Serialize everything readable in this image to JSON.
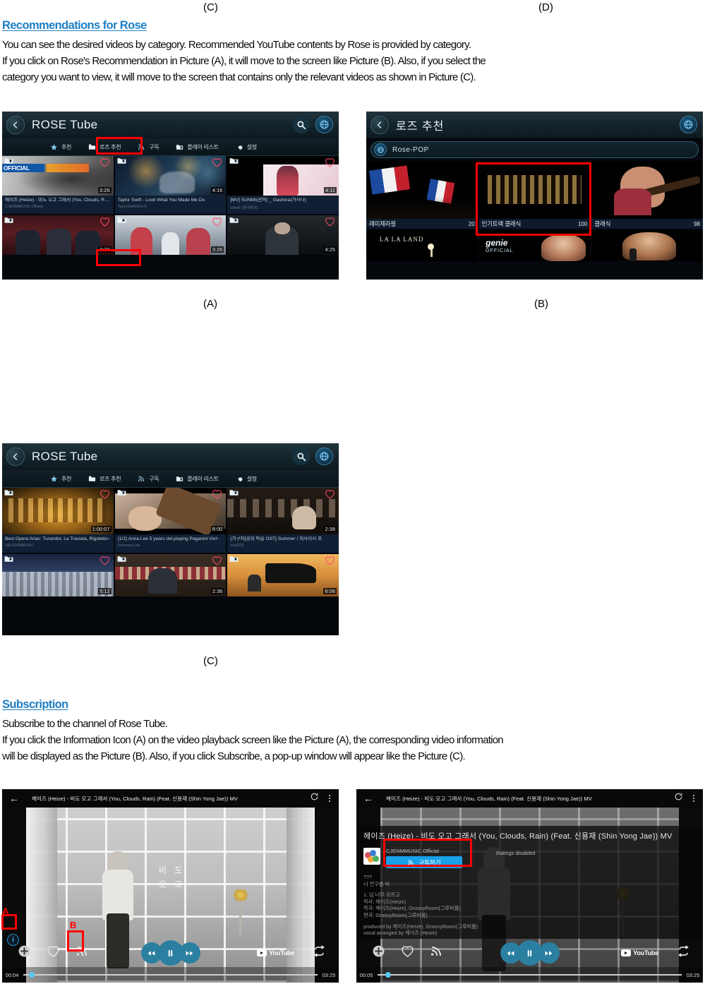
{
  "doc": {
    "top_refs": [
      "(C)",
      "(D)"
    ],
    "section1": {
      "heading": "Recommendations for Rose",
      "lines": [
        "You can see the desired videos by category. Recommended YouTube contents by Rose is provided by category.",
        "If you click on Rose's Recommendation in Picture (A), it will move to the screen like Picture (B). Also, if you select the",
        "category you want to view, it will move to the screen that contains only the relevant videos as shown in Picture (C)."
      ]
    },
    "section2": {
      "heading": "Subscription",
      "lines": [
        "Subscribe to the channel of Rose Tube.",
        "If you click the Information Icon (A) on the video playback screen like the Picture (A), the corresponding video information",
        "will be displayed as the Picture (B). Also, if you click Subscribe, a pop-up window will appear like the Picture (C)."
      ]
    },
    "captions": {
      "a": "(A)",
      "b": "(B)",
      "c": "(C)"
    }
  },
  "screen_a": {
    "title": "ROSE Tube",
    "tabs": [
      {
        "label": "추천",
        "icon": "star-icon",
        "active": false
      },
      {
        "label": "로즈 추천",
        "icon": "folder-icon",
        "active": true
      },
      {
        "label": "구독",
        "icon": "rss-icon",
        "active": false
      },
      {
        "label": "플레이 리스트",
        "icon": "playlist-icon",
        "active": false
      },
      {
        "label": "설정",
        "icon": "gear-icon",
        "active": false
      }
    ],
    "videos": [
      {
        "title": "헤이즈 (Heize) - 비도 오고 그래서 (You, Clouds, Rain~",
        "channel": "CJENMMUSIC Official",
        "duration": "3:26"
      },
      {
        "title": "Taylor Swift - Look What You Made Me Do",
        "channel": "TaylorSwiftVEVO",
        "duration": "4:16"
      },
      {
        "title": "[MV] SUNMI(선미) _ Gashina(가시나)",
        "channel": "1theK (원더케이)",
        "duration": "4:11"
      },
      {
        "title": "",
        "channel": "",
        "duration": "3:22"
      },
      {
        "title": "",
        "channel": "",
        "duration": "3:26"
      },
      {
        "title": "",
        "channel": "",
        "duration": "4:25"
      }
    ]
  },
  "screen_b": {
    "title": "로즈 추천",
    "dropdown_value": "Rose-POP",
    "categories": [
      {
        "name": "레미제라블",
        "count": "20"
      },
      {
        "name": "인기트랙 클래식",
        "count": "100"
      },
      {
        "name": "클래식",
        "count": "98"
      },
      {
        "name": "",
        "count": ""
      },
      {
        "name": "",
        "count": ""
      },
      {
        "name": "",
        "count": ""
      }
    ]
  },
  "screen_c": {
    "title": "ROSE Tube",
    "tabs": [
      {
        "label": "추천",
        "icon": "star-icon",
        "active": false
      },
      {
        "label": "로즈 추천",
        "icon": "folder-icon",
        "active": true
      },
      {
        "label": "구독",
        "icon": "rss-icon",
        "active": false
      },
      {
        "label": "플레이 리스트",
        "icon": "playlist-icon",
        "active": false
      },
      {
        "label": "설정",
        "icon": "gear-icon",
        "active": false
      }
    ],
    "videos": [
      {
        "title": "Best Opera Arias: Turandot, La Traviata, Rigoletto~",
        "channel": "HALIDONMUSIC",
        "duration": "1:00:07"
      },
      {
        "title": "(1/2) Anna Lee 5 years old playing Paganini Viol~",
        "channel": "Solomon Lee",
        "duration": "8:00"
      },
      {
        "title": "(가구자[쿵의 마을 OST] Summer / 히사이시 조",
        "channel": "anaR23",
        "duration": "2:38"
      },
      {
        "title": "",
        "channel": "",
        "duration": "5:12"
      },
      {
        "title": "",
        "channel": "",
        "duration": "2:36"
      },
      {
        "title": "",
        "channel": "",
        "duration": "6:06"
      }
    ]
  },
  "player_a": {
    "title": "헤이즈 (Heize) - 비도 오고 그래서 (You, Clouds, Rain) (Feat. 신용재 (Shin Yong Jae)) MV",
    "time_current": "00:04",
    "time_total": "03:25",
    "marker_a": "A",
    "marker_b": "B",
    "youtube_label": "YouTube",
    "overlay_text_1": "비 도",
    "overlay_text_2": "오 고"
  },
  "player_b": {
    "title": "헤이즈 (Heize) - 비도 오고 그래서 (You, Clouds, Rain) (Feat. 신용재 (Shin Yong Jae)) MV",
    "info_title": "헤이즈 (Heize) - 비도 오고 그래서 (You, Clouds, Rain) (Feat. 신용재 (Shin Yong Jae)) MV",
    "channel": "CJENMMUSIC Official",
    "subscribe_label": "구독하기",
    "ratings": "Ratings disabled",
    "detail_lines": [
      "???",
      "너 언구름 비",
      "",
      "1. 님 너무 모르고",
      "작사: 헤이즈(Heize)",
      "작곡: 헤이즈(Heize), GroovyRoom(그루비룸)",
      "편곡: GroovyRoom(그루비룸)",
      "",
      "produced by 헤이즈(Heize), GroovyRoom(그루비룸)",
      "vocal arranged by 헤이즈 (Heize)"
    ],
    "time_current": "00:05",
    "time_total": "03:25",
    "youtube_label": "YouTube"
  },
  "colors": {
    "accent_blue": "#1F7FC4",
    "highlight_red": "#FF0000",
    "subscribe_blue": "#18A0E8",
    "player_control": "#2B7FA0",
    "card_bg": "#101F33"
  }
}
